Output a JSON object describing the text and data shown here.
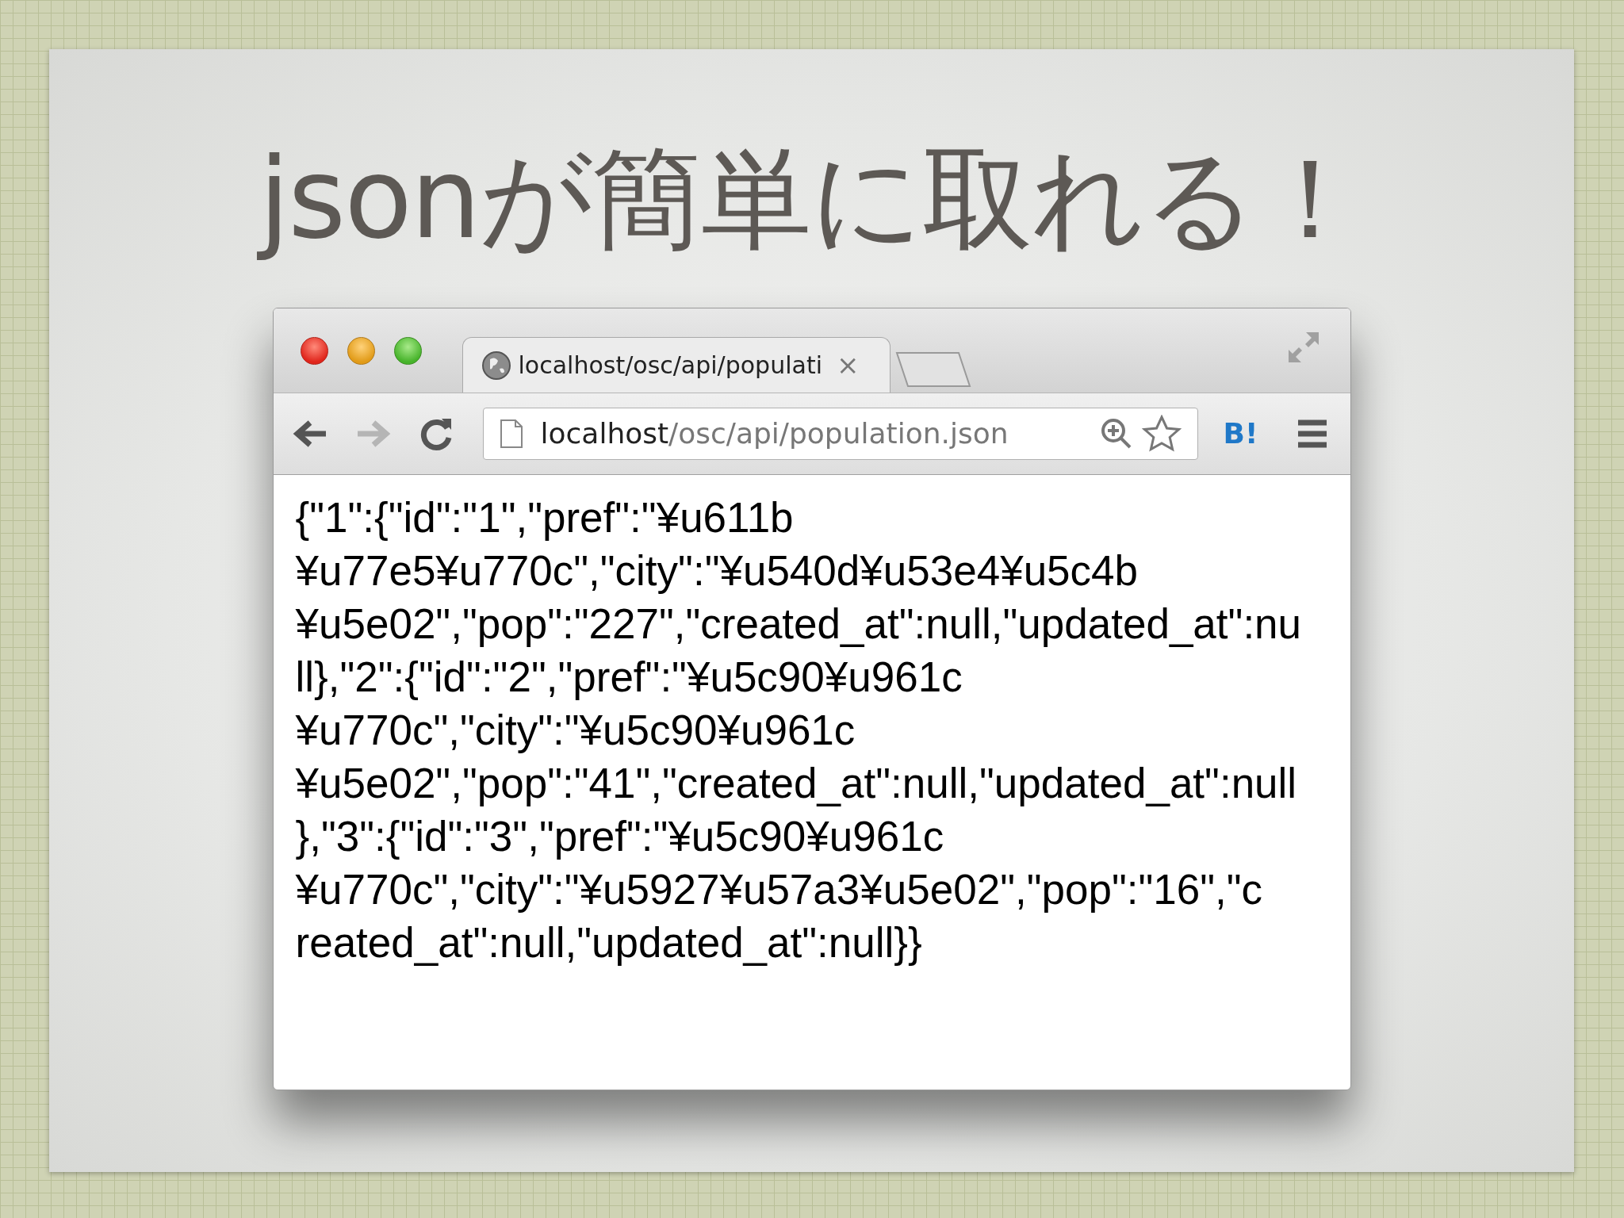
{
  "slide": {
    "title": "jsonが簡単に取れる！"
  },
  "browser": {
    "tab": {
      "title": "localhost/osc/api/populati",
      "close": "×",
      "selected": true
    },
    "address": {
      "host": "localhost",
      "path": "/osc/api/population.json"
    },
    "extension": "B!",
    "page_lines": [
      "{\"1\":{\"id\":\"1\",\"pref\":\"¥u611b",
      "¥u77e5¥u770c\",\"city\":\"¥u540d¥u53e4¥u5c4b",
      "¥u5e02\",\"pop\":\"227\",\"created_at\":null,\"updated_at\":nu",
      "ll},\"2\":{\"id\":\"2\",\"pref\":\"¥u5c90¥u961c",
      "¥u770c\",\"city\":\"¥u5c90¥u961c",
      "¥u5e02\",\"pop\":\"41\",\"created_at\":null,\"updated_at\":null",
      "},\"3\":{\"id\":\"3\",\"pref\":\"¥u5c90¥u961c",
      "¥u770c\",\"city\":\"¥u5927¥u57a3¥u5e02\",\"pop\":\"16\",\"c",
      "reated_at\":null,\"updated_at\":null}}"
    ]
  }
}
